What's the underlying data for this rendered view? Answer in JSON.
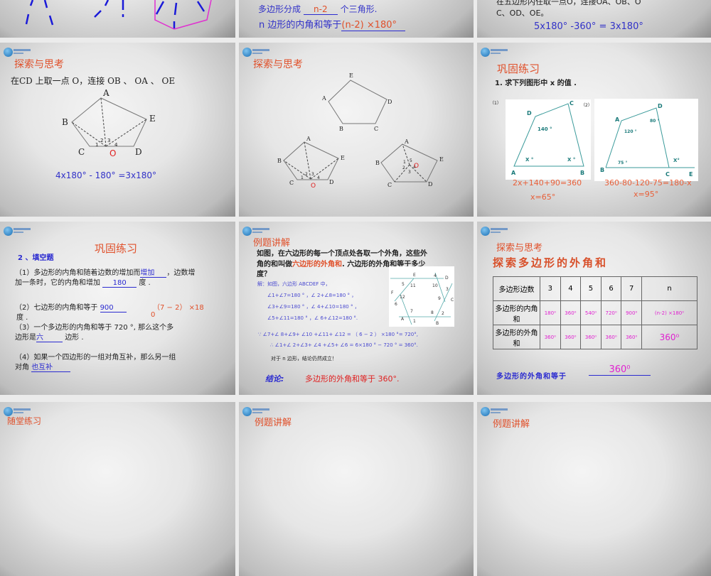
{
  "slides_row1": {
    "middle": {
      "line1_prefix": "多边形分成",
      "line1_blank": "n-2",
      "line1_suffix": "个三角形.",
      "line2_prefix": "n 边形的内角和等于",
      "line2_blank": "(n-2) ×180°"
    },
    "right": {
      "line1": "在五边形内任取一点O，连接OA、OB、O",
      "line2": "C、OD、OE。",
      "equation": "5x180°  -360° = 3x180°"
    }
  },
  "slide_cd": {
    "title": "探索与思考",
    "text": "在CD 上取一点 O，连接 OB 、 OA 、 OE",
    "labels": {
      "A": "A",
      "B": "B",
      "C": "C",
      "D": "D",
      "E": "E",
      "O": "O",
      "n1": "1",
      "n2": "2",
      "n3": "3",
      "n4": "4"
    },
    "equation": "4x180°  - 180°  =3x180°"
  },
  "slide_pentagons": {
    "title": "探索与思考",
    "labels": {
      "A": "A",
      "B": "B",
      "C": "C",
      "D": "D",
      "E": "E",
      "O": "O",
      "n1": "1",
      "n2": "2",
      "n3": "3",
      "n4": "4",
      "n5": "5"
    }
  },
  "slide_x": {
    "title": "巩固练习",
    "question": "1. 求下列图形中  x  的值  .",
    "fig1": {
      "num": "（1）",
      "A": "A",
      "B": "B",
      "C": "C",
      "D": "D",
      "angle_d": "140 °",
      "x1": "X °",
      "x2": "X °"
    },
    "fig2": {
      "num": "（2）",
      "A": "A",
      "B": "B",
      "C": "C",
      "D": "D",
      "E": "E",
      "angle_a": "120 °",
      "angle_d": "80 °",
      "angle_b": "75 °",
      "x": "X°"
    },
    "eq1": "2x+140+90=360",
    "ans1": "x=65°",
    "eq2": "360-80-120-75=180-x",
    "ans2": "x=95°"
  },
  "slide_fill": {
    "title": "巩固练习",
    "subtitle": "2 、填空题",
    "q1a": "（1）多边形的内角和随着边数的增加而",
    "q1_blank1": "增加",
    "q1b": "，边数增",
    "q1c": "加一条时，它的内角和增加",
    "q1_blank2": "180",
    "q1d": "度 .",
    "q2a": "（2）七边形的内角和等于",
    "q2_blank": "900",
    "q2_note1": "（7 − 2） ×18",
    "q2_note2": "0",
    "q2b": "度 .",
    "q3a": "（3）一个多边形的内角和等于 720 °, 那么这个多",
    "q3b": "边形是",
    "q3_blank": "六",
    "q3c": "边形 .",
    "q4a": "（4）如果一个四边形的一组对角互补，那么另一组",
    "q4b": "对角",
    "q4_blank": "也互补"
  },
  "slide_example": {
    "title": "例题讲解",
    "p1": "如图，在六边形的每一个顶点处各取一个外角，这些外",
    "p2a": "角的和叫做",
    "p2_highlight": "六边形的外角和",
    "p2b": ".  六边形的外角和等于多少",
    "p3": "度？",
    "s0": "解：如图，六边形 ABCDEF 中，",
    "s1": "∠1+∠7=180 ° ，∠ 2+∠8=180 ° ，",
    "s2": "∠3+∠9=180 ° ，∠ 4+∠10=180 ° ，",
    "s3": "∠5+∠11=180 ° ，∠ 6+∠12=180 °.",
    "s4": "∵ ∠7+∠ 8+∠9+ ∠10 +∠11+ ∠12 = （ 6 − 2 ） ×180 °= 720°,",
    "s5": "∴ ∠1+∠ 2+∠3+ ∠4 +∠5+ ∠6  =  6×180 ° − 720 ° =  360°.",
    "s6": "对于  n 边形，结论仍然成立！",
    "conclusion_label": "结论:",
    "conclusion": "多边形的外角和等于 360°.",
    "fig": {
      "A": "A",
      "B": "B",
      "C": "C",
      "D": "D",
      "E": "E",
      "F": "F",
      "n1": "1",
      "n2": "2",
      "n3": "3",
      "n4": "4",
      "n5": "5",
      "n6": "6",
      "n7": "7",
      "n8": "8",
      "n9": "9",
      "n10": "10",
      "n11": "11",
      "n12": "12"
    }
  },
  "slide_table": {
    "title": "探索与思考",
    "heading": "探索多边形的外角和",
    "headers": [
      "多边形边数",
      "3",
      "4",
      "5",
      "6",
      "7",
      "n"
    ],
    "row_interior": [
      "多边形的内角和",
      "180⁰",
      "360⁰",
      "540⁰",
      "720⁰",
      "900⁰",
      "(n-2) ×180⁰"
    ],
    "row_exterior": [
      "多边形的外角和",
      "360⁰",
      "360⁰",
      "360⁰",
      "360⁰",
      "360⁰",
      "360⁰"
    ],
    "conclusion_prefix": "多边形的外角和等于",
    "conclusion_blank": "360⁰"
  },
  "slides_row4": [
    "随堂练习",
    "例题讲解",
    "例题讲解"
  ]
}
